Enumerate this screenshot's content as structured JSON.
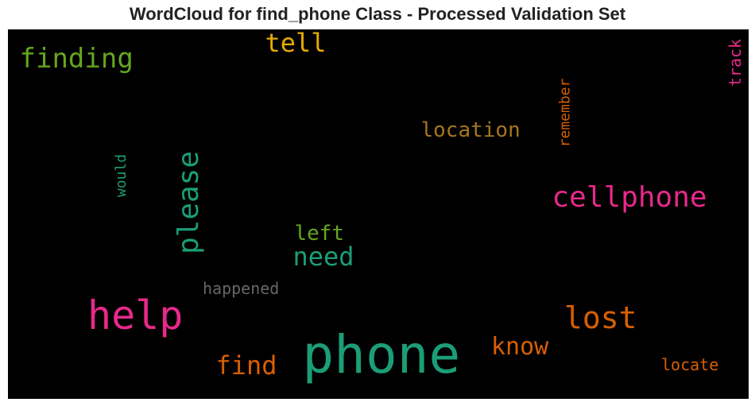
{
  "chart_data": {
    "type": "wordcloud",
    "title": "WordCloud for find_phone Class - Processed Validation Set",
    "background": "#000000",
    "words": [
      {
        "text": "phone",
        "color": "#1b9e77",
        "orientation": "horizontal"
      },
      {
        "text": "help",
        "color": "#e7298a",
        "orientation": "horizontal"
      },
      {
        "text": "cellphone",
        "color": "#e7298a",
        "orientation": "horizontal"
      },
      {
        "text": "lost",
        "color": "#d95f02",
        "orientation": "horizontal"
      },
      {
        "text": "please",
        "color": "#1b9e77",
        "orientation": "vertical"
      },
      {
        "text": "finding",
        "color": "#66a61e",
        "orientation": "horizontal"
      },
      {
        "text": "tell",
        "color": "#e6ab02",
        "orientation": "horizontal"
      },
      {
        "text": "find",
        "color": "#d95f02",
        "orientation": "horizontal"
      },
      {
        "text": "know",
        "color": "#d95f02",
        "orientation": "horizontal"
      },
      {
        "text": "need",
        "color": "#1b9e77",
        "orientation": "horizontal"
      },
      {
        "text": "location",
        "color": "#a6761d",
        "orientation": "horizontal"
      },
      {
        "text": "left",
        "color": "#66a61e",
        "orientation": "horizontal"
      },
      {
        "text": "track",
        "color": "#e7298a",
        "orientation": "vertical"
      },
      {
        "text": "remember",
        "color": "#d95f02",
        "orientation": "vertical"
      },
      {
        "text": "happened",
        "color": "#666666",
        "orientation": "horizontal"
      },
      {
        "text": "locate",
        "color": "#d95f02",
        "orientation": "horizontal"
      },
      {
        "text": "would",
        "color": "#1b9e77",
        "orientation": "vertical"
      }
    ]
  }
}
